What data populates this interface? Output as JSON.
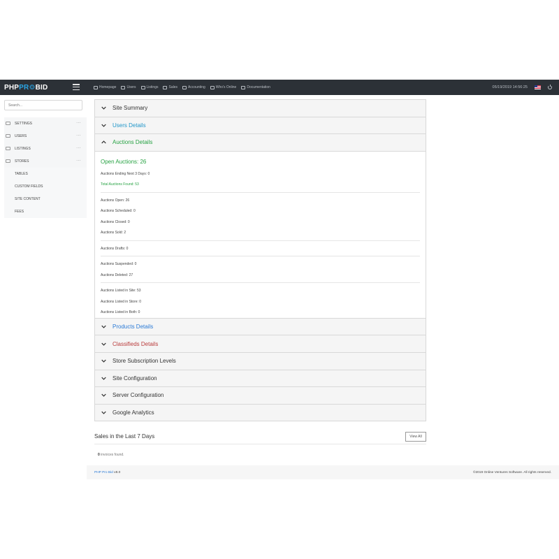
{
  "header": {
    "logo_part1": "PHP",
    "logo_part2": "PR",
    "logo_part3": "BID",
    "nav": [
      {
        "label": "Homepage",
        "icon": "monitor-icon"
      },
      {
        "label": "Users",
        "icon": "users-icon"
      },
      {
        "label": "Listings",
        "icon": "layers-icon"
      },
      {
        "label": "Sales",
        "icon": "calendar-icon"
      },
      {
        "label": "Accounting",
        "icon": "credit-card-icon"
      },
      {
        "label": "Who's Online",
        "icon": "people-icon"
      },
      {
        "label": "Documentation",
        "icon": "book-icon"
      }
    ],
    "datetime": "05/19/2019 14:56:25"
  },
  "sidebar": {
    "search_placeholder": "Search...",
    "items": [
      {
        "label": "SETTINGS"
      },
      {
        "label": "USERS"
      },
      {
        "label": "LISTINGS"
      },
      {
        "label": "STORES"
      },
      {
        "label": "TABLES"
      },
      {
        "label": "CUSTOM FIELDS"
      },
      {
        "label": "SITE CONTENT"
      },
      {
        "label": "FEES"
      }
    ]
  },
  "accordion": {
    "site_summary": "Site Summary",
    "users_details": "Users Details",
    "auctions_details": "Auctions Details",
    "products_details": "Products Details",
    "classifieds_details": "Classifieds Details",
    "store_subscription": "Store Subscription Levels",
    "site_configuration": "Site Configuration",
    "server_configuration": "Server Configuration",
    "google_analytics": "Google Analytics"
  },
  "auctions": {
    "open_title": "Open Auctions: 26",
    "ending": "Auctions Ending Next 3 Days: 0",
    "total_found": "Total Auctions Found: 53",
    "open": "Auctions Open: 26",
    "scheduled": "Auctions Scheduled: 0",
    "closed": "Auctions Closed: 0",
    "sold": "Auctions Sold: 2",
    "drafts": "Auctions Drafts: 0",
    "suspended": "Auctions Suspended: 0",
    "deleted": "Auctions Deleted: 27",
    "listed_site": "Auctions Listed in Site: 53",
    "listed_store": "Auctions Listed in Store: 0",
    "listed_both": "Auctions Listed in Both: 0"
  },
  "sales": {
    "title": "Sales in the Last 7 Days",
    "view_all": "View All",
    "invoice_count": "0",
    "invoice_text": " invoices found."
  },
  "footer": {
    "brand": "PHP Pro Bid",
    "version": " v8.0",
    "copyright": "©2019 Online Ventures Software. All rights reserved."
  }
}
